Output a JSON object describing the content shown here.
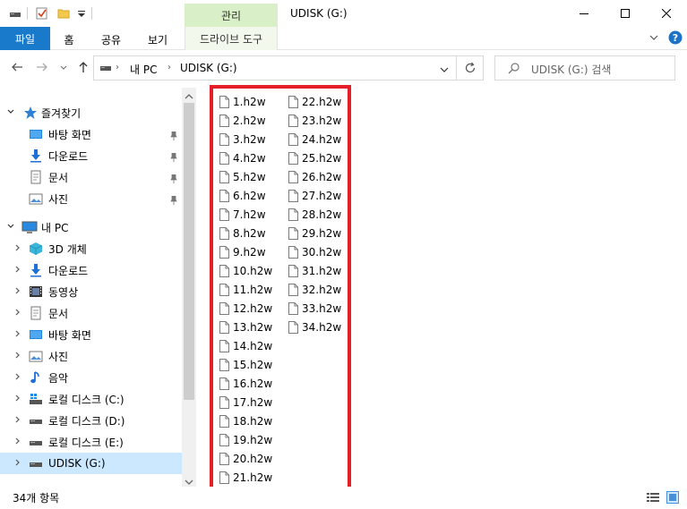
{
  "window": {
    "title": "UDISK (G:)",
    "context_tab": "관리"
  },
  "ribbon": {
    "tabs": [
      "파일",
      "홈",
      "공유",
      "보기",
      "드라이브 도구"
    ]
  },
  "address": {
    "crumbs": [
      "내 PC",
      "UDISK (G:)"
    ]
  },
  "search": {
    "placeholder": "UDISK (G:) 검색"
  },
  "nav": {
    "quick_access": {
      "label": "즐겨찾기",
      "items": [
        "바탕 화면",
        "다운로드",
        "문서",
        "사진"
      ]
    },
    "this_pc": {
      "label": "내 PC",
      "items": [
        "3D 개체",
        "다운로드",
        "동영상",
        "문서",
        "바탕 화면",
        "사진",
        "음악",
        "로컬 디스크 (C:)",
        "로컬 디스크 (D:)",
        "로컬 디스크 (E:)",
        "UDISK (G:)"
      ]
    },
    "selected_item": "UDISK (G:)"
  },
  "files": {
    "column1": [
      "1.h2w",
      "2.h2w",
      "3.h2w",
      "4.h2w",
      "5.h2w",
      "6.h2w",
      "7.h2w",
      "8.h2w",
      "9.h2w",
      "10.h2w",
      "11.h2w",
      "12.h2w",
      "13.h2w",
      "14.h2w",
      "15.h2w",
      "16.h2w",
      "17.h2w",
      "18.h2w",
      "19.h2w",
      "20.h2w",
      "21.h2w"
    ],
    "column2": [
      "22.h2w",
      "23.h2w",
      "24.h2w",
      "25.h2w",
      "26.h2w",
      "27.h2w",
      "28.h2w",
      "29.h2w",
      "30.h2w",
      "31.h2w",
      "32.h2w",
      "33.h2w",
      "34.h2w"
    ]
  },
  "status": {
    "item_count": "34개 항목"
  },
  "colors": {
    "accent": "#1979ca",
    "highlight_box": "#e61e27",
    "context_tab": "#d9efc7",
    "selected": "#cce8ff"
  }
}
